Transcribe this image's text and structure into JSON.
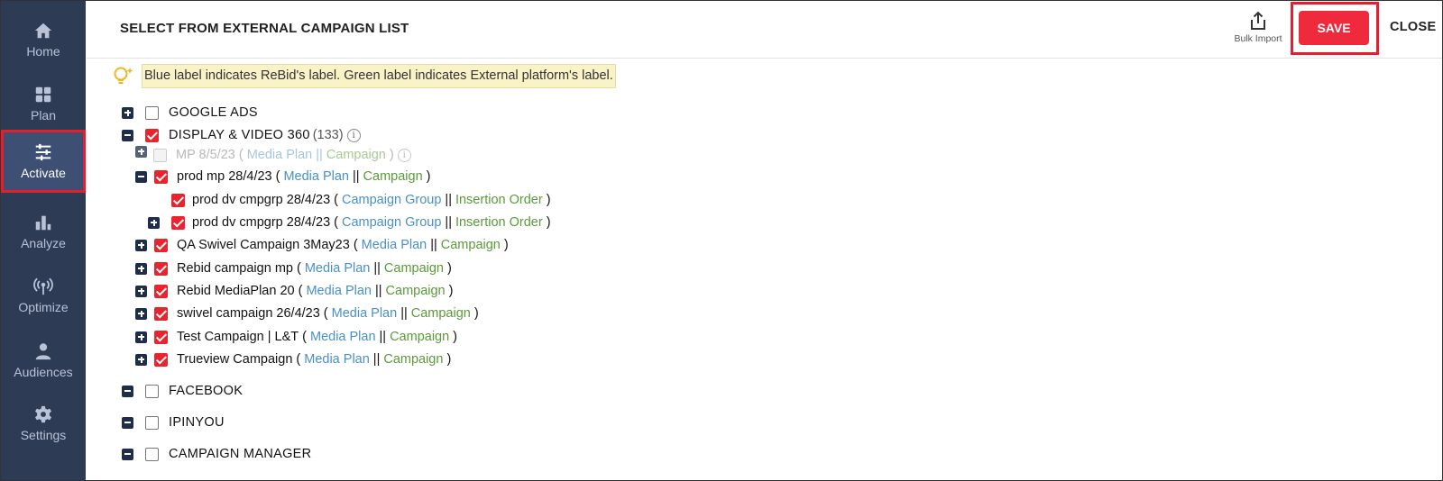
{
  "sidebar": {
    "items": [
      {
        "label": "Home",
        "icon": "home-icon"
      },
      {
        "label": "Plan",
        "icon": "grid-icon"
      },
      {
        "label": "Activate",
        "icon": "sliders-icon",
        "active": true
      },
      {
        "label": "Analyze",
        "icon": "bar-chart-icon"
      },
      {
        "label": "Optimize",
        "icon": "broadcast-icon"
      },
      {
        "label": "Audiences",
        "icon": "user-icon"
      },
      {
        "label": "Settings",
        "icon": "gear-icon"
      }
    ]
  },
  "header": {
    "title": "SELECT FROM EXTERNAL CAMPAIGN LIST",
    "bulk_import": "Bulk Import",
    "save": "SAVE",
    "close": "CLOSE"
  },
  "info_text": "Blue label indicates ReBid's label. Green label indicates External platform's label.",
  "tree": {
    "google_ads": "GOOGLE ADS",
    "dv360": "DISPLAY & VIDEO 360",
    "dv360_count": "(133)",
    "mp": {
      "name": "MP 8/5/23",
      "blue": "Media Plan",
      "green": "Campaign"
    },
    "prod_mp": {
      "name": "prod mp 28/4/23",
      "blue": "Media Plan",
      "green": "Campaign"
    },
    "prod_grp1": {
      "name": "prod dv cmpgrp 28/4/23",
      "blue": "Campaign Group",
      "green": "Insertion Order"
    },
    "prod_grp2": {
      "name": "prod dv cmpgrp 28/4/23",
      "blue": "Campaign Group",
      "green": "Insertion Order"
    },
    "qa_swivel": {
      "name": "QA Swivel Campaign 3May23",
      "blue": "Media Plan",
      "green": "Campaign"
    },
    "rebid_mp": {
      "name": "Rebid campaign mp",
      "blue": "Media Plan",
      "green": "Campaign"
    },
    "rebid_mp20": {
      "name": "Rebid MediaPlan 20",
      "blue": "Media Plan",
      "green": "Campaign"
    },
    "swivel": {
      "name": "swivel campaign 26/4/23",
      "blue": "Media Plan",
      "green": "Campaign"
    },
    "test_campaign": {
      "name": "Test Campaign | L&T",
      "blue": "Media Plan",
      "green": "Campaign"
    },
    "trueview": {
      "name": "Trueview Campaign",
      "blue": "Media Plan",
      "green": "Campaign"
    },
    "facebook": "FACEBOOK",
    "ipinyou": "IPINYOU",
    "campaign_manager": "CAMPAIGN MANAGER"
  },
  "colors": {
    "sidebar_bg": "#2e3b55",
    "accent_red": "#ee2a3c",
    "label_blue": "#4a90c6",
    "label_green": "#5a9a3a"
  }
}
